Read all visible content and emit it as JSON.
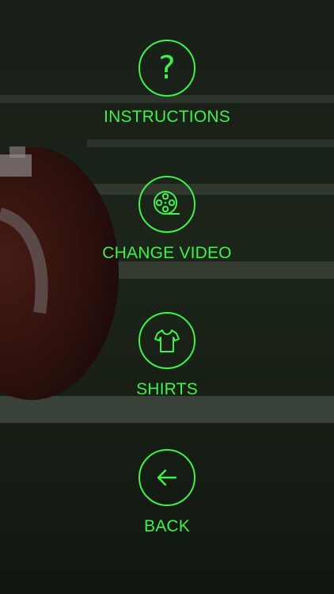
{
  "theme": {
    "accent": "#3ff24b"
  },
  "menu": {
    "items": [
      {
        "label": "INSTRUCTIONS",
        "icon": "question-mark-icon",
        "glyph": "?"
      },
      {
        "label": "CHANGE VIDEO",
        "icon": "film-reel-icon"
      },
      {
        "label": "SHIRTS",
        "icon": "shirt-icon"
      },
      {
        "label": "BACK",
        "icon": "arrow-left-icon"
      }
    ]
  }
}
